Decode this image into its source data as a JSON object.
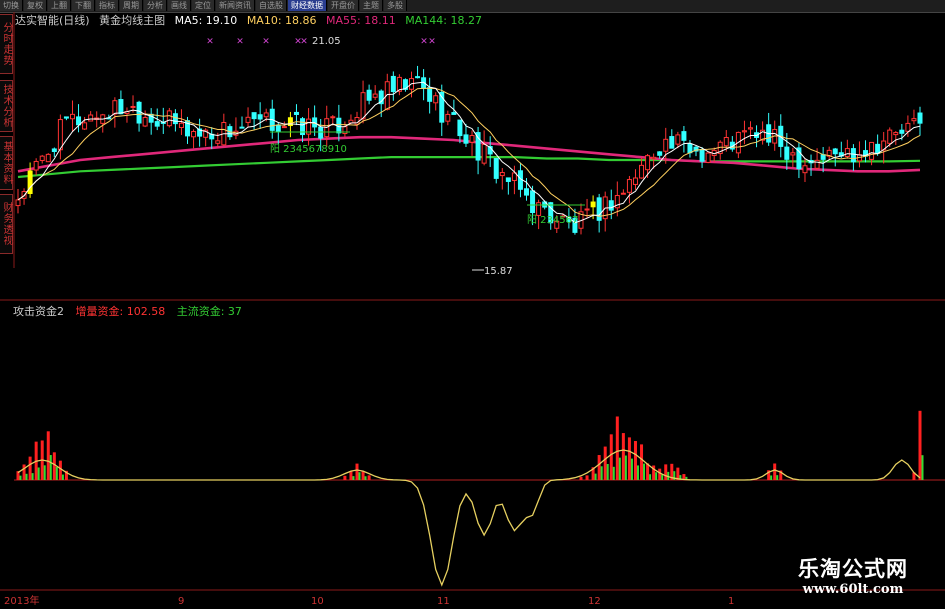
{
  "toolbar": {
    "items": [
      "切换",
      "复权",
      "上翻",
      "下翻",
      "指标",
      "周期",
      "分析",
      "画线",
      "定位",
      "新闻资讯",
      "自选股",
      "财经数据",
      "开盘价",
      "主题",
      "多股"
    ],
    "active_index": 11
  },
  "side_tabs": [
    "分时走势",
    "技术分析",
    "基本资料",
    "财务透视"
  ],
  "info": {
    "stock": "达实智能(日线)",
    "indicator": "黄金均线主图",
    "ma5": "MA5: 19.10",
    "ma10": "MA10: 18.86",
    "ma55": "MA55: 18.11",
    "ma144": "MA144: 18.27"
  },
  "sub_info": {
    "name": "攻击资金2",
    "inc": "增量资金: 102.58",
    "main": "主流资金: 37"
  },
  "colors": {
    "up": "#ff3333",
    "down": "#33ffff",
    "ma5": "#ffffff",
    "ma10": "#ffd060",
    "ma55": "#e0287a",
    "ma144": "#33cc33",
    "yellow_candle": "#ffff00",
    "red_bar": "#ff2020",
    "green_bar": "#33dd33",
    "yellow_line": "#e6d060",
    "info_label": "#cccccc",
    "info_ma5": "#ffffff",
    "info_ma10": "#ffd060",
    "info_ma55": "#e0287a",
    "info_ma144": "#33cc33",
    "sub_name": "#cccccc",
    "sub_inc": "#ff3333",
    "sub_main": "#33cc33",
    "annotation_green": "#33cc33",
    "markers": "#cc44cc"
  },
  "dates": [
    {
      "label": "2013年"
    },
    {
      "label": "9"
    },
    {
      "label": "10"
    },
    {
      "label": "11"
    },
    {
      "label": "12"
    },
    {
      "label": "1"
    }
  ],
  "watermark": {
    "title": "乐淘公式网",
    "url": "www.60lt.com"
  },
  "chart_data": {
    "type": "candlestick",
    "price_range": [
      14.5,
      22.8
    ],
    "annotations": {
      "high": "21.05",
      "low": "15.87",
      "seq1": "阳 2345678910",
      "seq2": "阳 234567"
    },
    "ma55": [
      17.9,
      18.1,
      18.3,
      18.4,
      18.5,
      18.6,
      18.7,
      18.8,
      18.9,
      19.0,
      19.05,
      19.1,
      19.1,
      19.05,
      19.0,
      18.9,
      18.8,
      18.7,
      18.6,
      18.5,
      18.4,
      18.3,
      18.25,
      18.2,
      18.1,
      18.0,
      17.95,
      17.9,
      17.9,
      17.95
    ],
    "ma144": [
      17.7,
      17.8,
      17.9,
      17.95,
      18.0,
      18.05,
      18.1,
      18.15,
      18.2,
      18.25,
      18.3,
      18.35,
      18.4,
      18.4,
      18.4,
      18.4,
      18.4,
      18.35,
      18.35,
      18.3,
      18.3,
      18.3,
      18.25,
      18.25,
      18.25,
      18.25,
      18.25,
      18.25,
      18.25,
      18.27
    ]
  }
}
